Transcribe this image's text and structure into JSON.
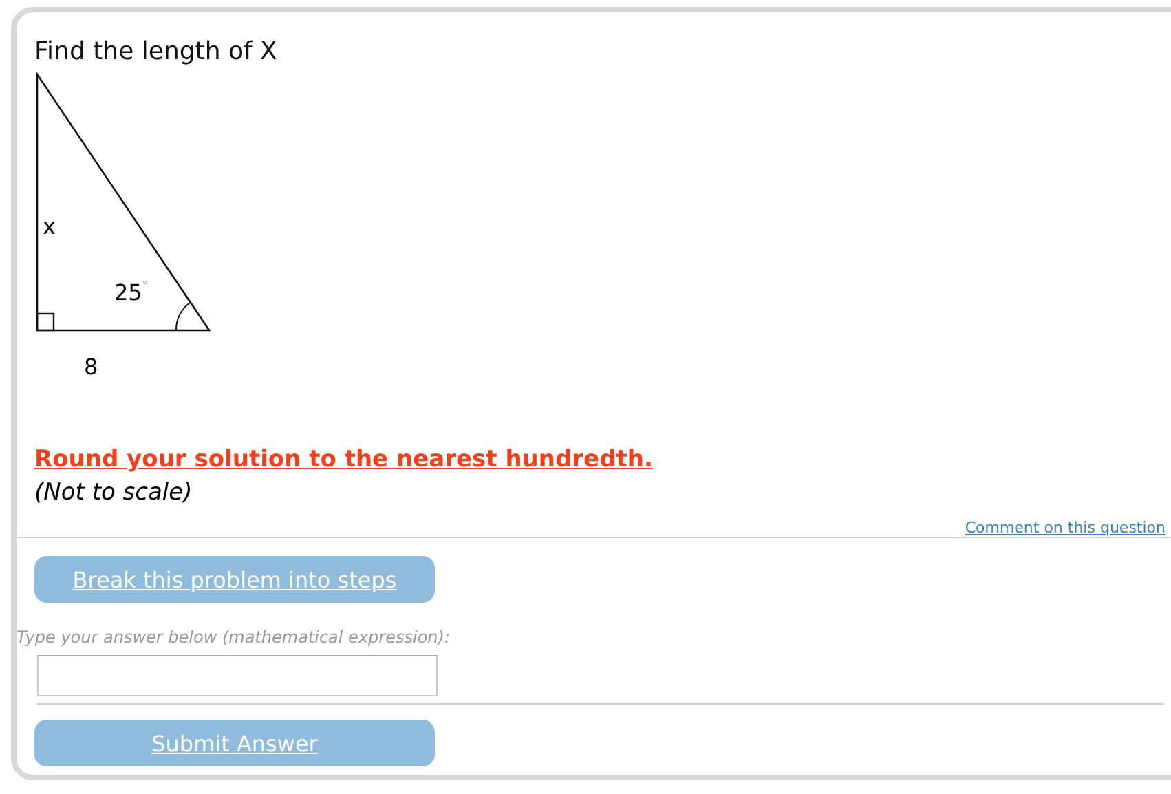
{
  "question": {
    "title": "Find the length of X",
    "figure": {
      "side_label": "x",
      "angle_label": "25",
      "degree_mark": "°",
      "base_label": "8"
    },
    "instruction": "Round your solution to the nearest hundredth.",
    "note": "(Not to scale)"
  },
  "comment_link": "Comment on this question",
  "steps_button": "Break this problem into steps",
  "answer": {
    "label": "Type your answer below (mathematical expression):"
  },
  "submit_button": "Submit Answer"
}
